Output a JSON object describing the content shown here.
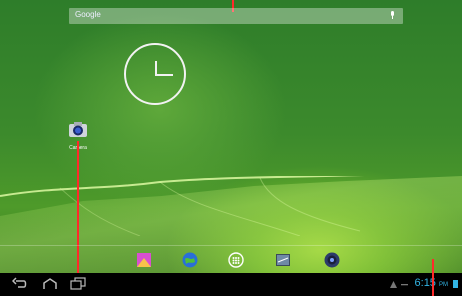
{
  "search": {
    "label": "Google"
  },
  "app_shortcut": {
    "label": "Camera"
  },
  "status_bar": {
    "time": "6:15",
    "ampm": "PM"
  },
  "dock": {
    "icons": [
      "gallery-icon",
      "browser-icon",
      "apps-icon",
      "email-icon",
      "camera-icon"
    ]
  },
  "nav": {
    "icons": [
      "back-icon",
      "home-icon",
      "recent-apps-icon"
    ]
  },
  "colors": {
    "accent": "#33b5e5",
    "annotation": "#ff2a2a"
  }
}
